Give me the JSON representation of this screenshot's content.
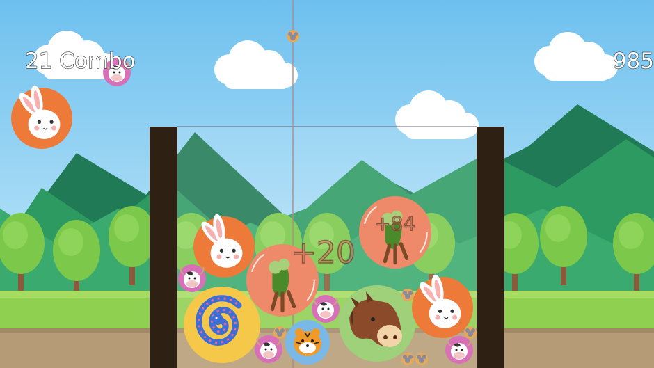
{
  "hud": {
    "combo_text": "21 Combo",
    "score_text": "985"
  },
  "score_popups": [
    "+20",
    "+84"
  ],
  "colors": {
    "sky_top": "#7ec8f0",
    "sky_bottom": "#c6e9f8",
    "mountain_dark": "#1f7a55",
    "mountain_mid": "#2d9a62",
    "grass": "#7cc84a",
    "ground": "#b9a07a",
    "container_wall": "#2e2012",
    "rabbit_ball": "#ee7a3a",
    "radish_ball": "#ee8a6a",
    "snake_ball": "#f5c84a",
    "horse_ball": "#9fd07a",
    "tiger_ball": "#7ab8e8",
    "cow_ball": "#e07ab8",
    "mouse_ball": "#e8a85a"
  },
  "pieces": [
    {
      "kind": "rabbit",
      "icon": "rabbit-ball-icon"
    },
    {
      "kind": "radish",
      "icon": "radish-ball-icon"
    },
    {
      "kind": "snake",
      "icon": "snake-ball-icon"
    },
    {
      "kind": "horse",
      "icon": "horse-ball-icon"
    },
    {
      "kind": "tiger",
      "icon": "tiger-ball-icon"
    },
    {
      "kind": "cow",
      "icon": "cow-ball-icon"
    },
    {
      "kind": "mouse",
      "icon": "mouse-ball-icon"
    }
  ]
}
